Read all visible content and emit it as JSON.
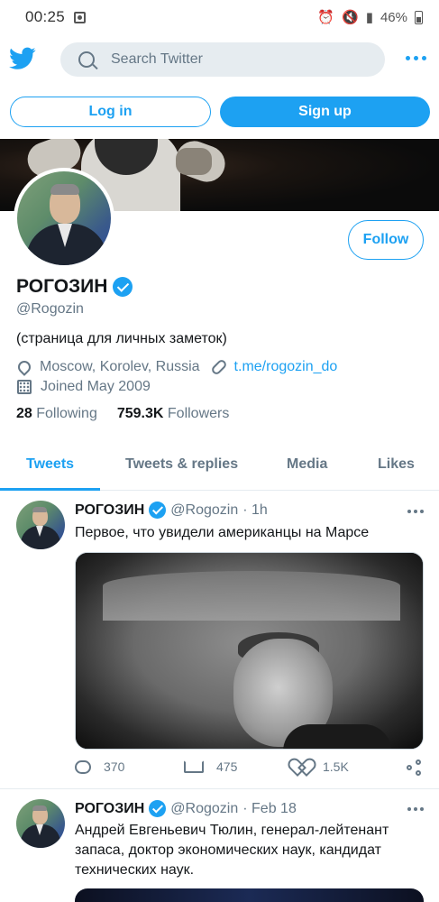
{
  "status_bar": {
    "time": "00:25",
    "battery": "46%"
  },
  "header": {
    "search_placeholder": "Search Twitter",
    "brand_color": "#1da1f2"
  },
  "auth": {
    "login_label": "Log in",
    "signup_label": "Sign up"
  },
  "profile": {
    "name": "РОГОЗИН",
    "handle": "@Rogozin",
    "bio": "(страница для личных заметок)",
    "location": "Moscow, Korolev, Russia",
    "link": "t.me/rogozin_do",
    "joined": "Joined May 2009",
    "following_count": "28",
    "following_label": "Following",
    "followers_count": "759.3K",
    "followers_label": "Followers",
    "follow_label": "Follow"
  },
  "tabs": [
    {
      "label": "Tweets",
      "active": true
    },
    {
      "label": "Tweets & replies",
      "active": false
    },
    {
      "label": "Media",
      "active": false
    },
    {
      "label": "Likes",
      "active": false
    }
  ],
  "tweets": [
    {
      "name": "РОГОЗИН",
      "handle": "@Rogozin",
      "time": "· 1h",
      "text": "Первое, что увидели американцы на Марсе",
      "replies": "370",
      "retweets": "475",
      "likes": "1.5K"
    },
    {
      "name": "РОГОЗИН",
      "handle": "@Rogozin",
      "time": "· Feb 18",
      "text": "Андрей Евгеньевич Тюлин, генерал-лейтенант запаса, доктор экономических наук, кандидат технических наук."
    }
  ]
}
